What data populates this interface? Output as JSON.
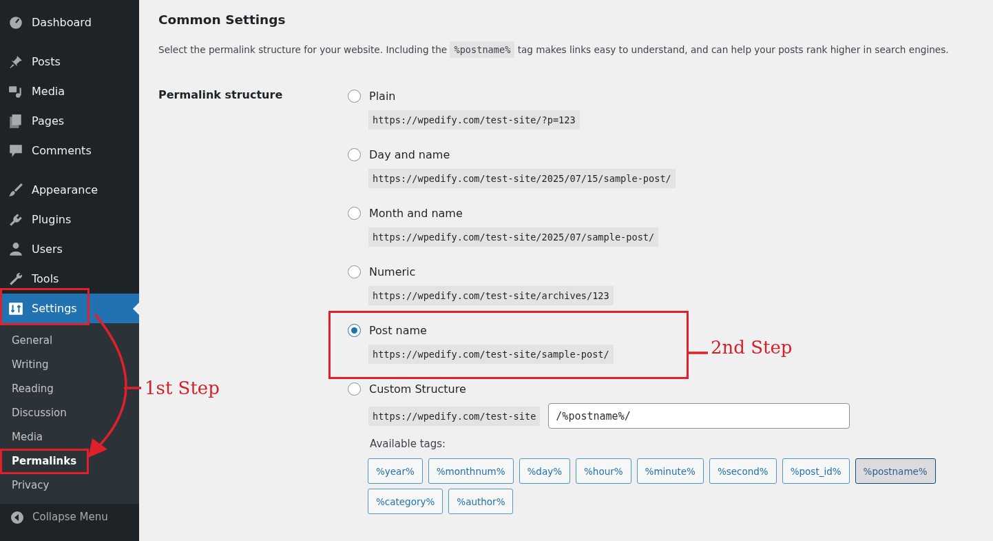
{
  "sidebar": {
    "groups": [
      {
        "items": [
          {
            "label": "Dashboard",
            "selected": false
          }
        ]
      },
      {
        "items": [
          {
            "label": "Posts",
            "selected": false
          },
          {
            "label": "Media",
            "selected": false
          },
          {
            "label": "Pages",
            "selected": false
          },
          {
            "label": "Comments",
            "selected": false
          }
        ]
      },
      {
        "items": [
          {
            "label": "Appearance",
            "selected": false
          },
          {
            "label": "Plugins",
            "selected": false
          },
          {
            "label": "Users",
            "selected": false
          },
          {
            "label": "Tools",
            "selected": false
          },
          {
            "label": "Settings",
            "selected": true,
            "children": [
              {
                "label": "General",
                "selected": false
              },
              {
                "label": "Writing",
                "selected": false
              },
              {
                "label": "Reading",
                "selected": false
              },
              {
                "label": "Discussion",
                "selected": false
              },
              {
                "label": "Media",
                "selected": false
              },
              {
                "label": "Permalinks",
                "selected": true
              },
              {
                "label": "Privacy",
                "selected": false
              }
            ]
          }
        ]
      }
    ],
    "collapse": "Collapse Menu"
  },
  "main": {
    "title": "Common Settings",
    "description": {
      "before": "Select the permalink structure for your website. Including the",
      "tag": "%postname%",
      "after": "tag makes links easy to understand, and can help your posts rank higher in search engines."
    },
    "field_label": "Permalink structure",
    "options": [
      {
        "kind": "preset",
        "label": "Plain",
        "url": "https://wpedify.com/test-site/?p=123",
        "selected": false
      },
      {
        "kind": "preset",
        "label": "Day and name",
        "url": "https://wpedify.com/test-site/2025/07/15/sample-post/",
        "selected": false
      },
      {
        "kind": "preset",
        "label": "Month and name",
        "url": "https://wpedify.com/test-site/2025/07/sample-post/",
        "selected": false
      },
      {
        "kind": "preset",
        "label": "Numeric",
        "url": "https://wpedify.com/test-site/archives/123",
        "selected": false
      },
      {
        "kind": "preset",
        "label": "Post name",
        "url": "https://wpedify.com/test-site/sample-post/",
        "selected": true
      },
      {
        "kind": "custom",
        "label": "Custom Structure",
        "url": "https://wpedify.com/test-site",
        "value": "/%postname%/",
        "tags_label": "Available tags:",
        "tags": [
          {
            "label": "%year%",
            "selected": false
          },
          {
            "label": "%monthnum%",
            "selected": false
          },
          {
            "label": "%day%",
            "selected": false
          },
          {
            "label": "%hour%",
            "selected": false
          },
          {
            "label": "%minute%",
            "selected": false
          },
          {
            "label": "%second%",
            "selected": false
          },
          {
            "label": "%post_id%",
            "selected": false
          },
          {
            "label": "%postname%",
            "selected": true
          },
          {
            "label": "%category%",
            "selected": false
          },
          {
            "label": "%author%",
            "selected": false
          }
        ],
        "selected": false
      }
    ]
  },
  "annotations": [
    {
      "text": "1st Step"
    },
    {
      "text": "2nd Step"
    }
  ]
}
